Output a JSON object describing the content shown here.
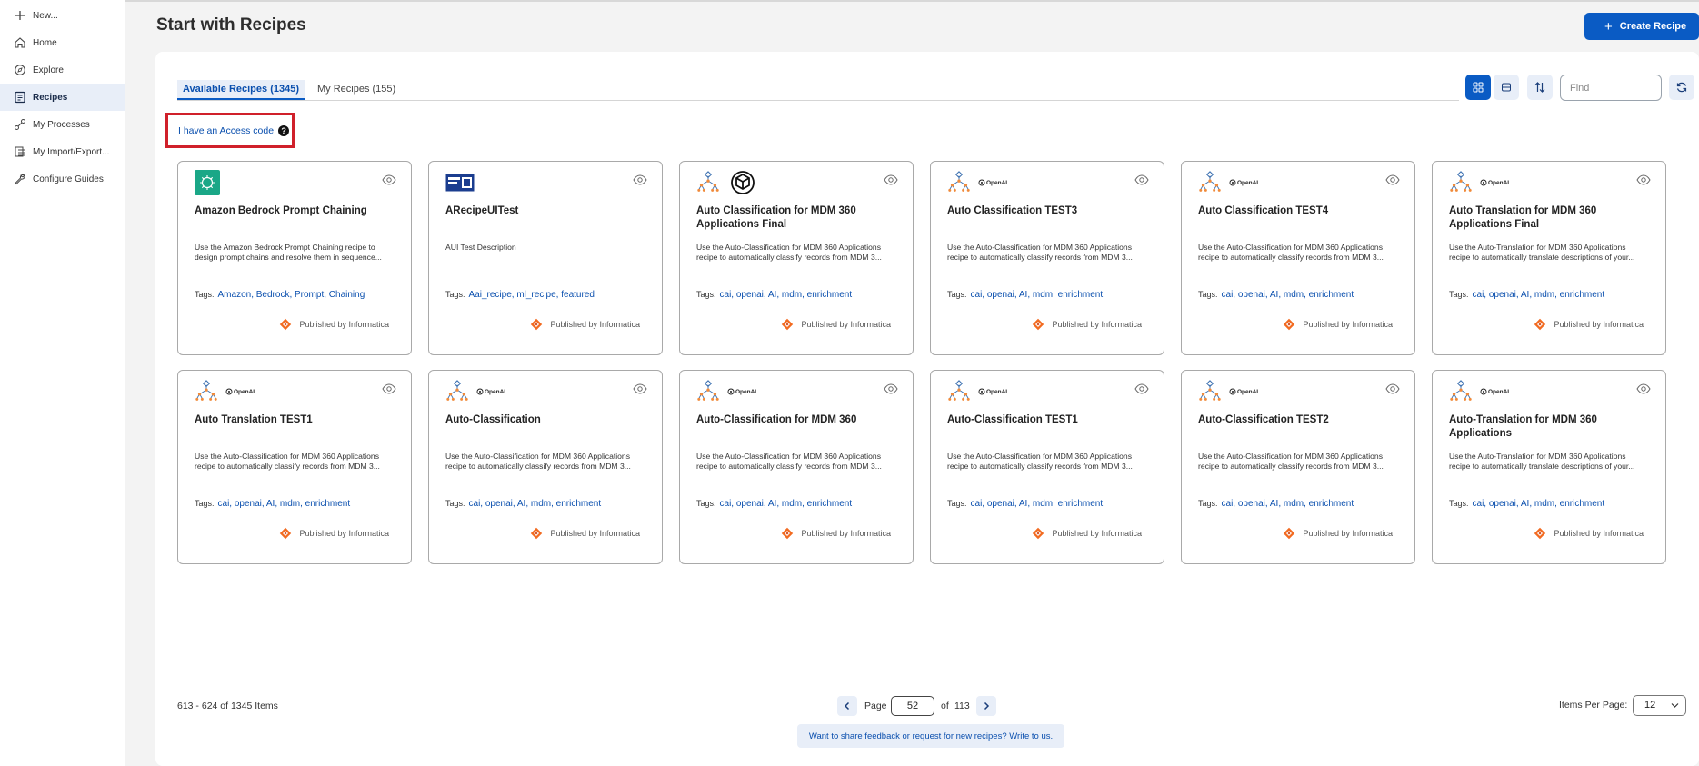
{
  "sidebar": {
    "items": [
      {
        "label": "New...",
        "icon": "plus-icon"
      },
      {
        "label": "Home",
        "icon": "home-icon"
      },
      {
        "label": "Explore",
        "icon": "compass-icon"
      },
      {
        "label": "Recipes",
        "icon": "recipes-icon",
        "active": true
      },
      {
        "label": "My Processes",
        "icon": "process-icon"
      },
      {
        "label": "My Import/Export...",
        "icon": "import-export-icon"
      },
      {
        "label": "Configure Guides",
        "icon": "wrench-icon"
      }
    ]
  },
  "header": {
    "title": "Start with Recipes",
    "create_button": "Create Recipe"
  },
  "tabs": [
    {
      "label": "Available Recipes (1345)",
      "active": true
    },
    {
      "label": "My Recipes (155)",
      "active": false
    }
  ],
  "toolbar": {
    "find_placeholder": "Find",
    "icons": [
      "grid-view-icon",
      "list-view-icon",
      "sort-icon",
      "refresh-icon"
    ]
  },
  "access_code": {
    "label": "I have an Access code",
    "help": "?"
  },
  "publisher_text": "Published by Informatica",
  "tags_label": "Tags:",
  "openai_label": "OpenAI",
  "cards": [
    {
      "title": "Amazon Bedrock Prompt Chaining",
      "desc": "Use the Amazon Bedrock Prompt Chaining recipe to design prompt chains and resolve them in sequence...",
      "tags": "Amazon, Bedrock, Prompt, Chaining",
      "logo": "bedrock"
    },
    {
      "title": "ARecipeUITest",
      "desc": "AUI Test Description",
      "tags": "Aai_recipe, ml_recipe, featured",
      "logo": "window"
    },
    {
      "title": "Auto Classification for MDM 360 Applications Final",
      "desc": "Use the Auto-Classification for MDM 360 Applications recipe to automatically classify records from MDM 3...",
      "tags": "cai, openai, AI, mdm, enrichment",
      "logo": "tree-openai-big"
    },
    {
      "title": "Auto Classification TEST3",
      "desc": "Use the Auto-Classification for MDM 360 Applications recipe to automatically classify records from MDM 3...",
      "tags": "cai, openai, AI, mdm, enrichment",
      "logo": "tree-openai"
    },
    {
      "title": "Auto Classification TEST4",
      "desc": "Use the Auto-Classification for MDM 360 Applications recipe to automatically classify records from MDM 3...",
      "tags": "cai, openai, AI, mdm, enrichment",
      "logo": "tree-openai"
    },
    {
      "title": "Auto Translation for MDM 360 Applications Final",
      "desc": "Use the Auto-Translation for MDM 360 Applications recipe to automatically translate descriptions of your...",
      "tags": "cai, openai, AI, mdm, enrichment",
      "logo": "tree-openai"
    },
    {
      "title": "Auto Translation TEST1",
      "desc": "Use the Auto-Classification for MDM 360 Applications recipe to automatically classify records from MDM 3...",
      "tags": "cai, openai, AI, mdm, enrichment",
      "logo": "tree-openai"
    },
    {
      "title": "Auto-Classification",
      "desc": "Use the Auto-Classification for MDM 360 Applications recipe to automatically classify records from MDM 3...",
      "tags": "cai, openai, AI, mdm, enrichment",
      "logo": "tree-openai"
    },
    {
      "title": "Auto-Classification for MDM 360",
      "desc": "Use the Auto-Classification for MDM 360 Applications recipe to automatically classify records from MDM 3...",
      "tags": "cai, openai, AI, mdm, enrichment",
      "logo": "tree-openai"
    },
    {
      "title": "Auto-Classification TEST1",
      "desc": "Use the Auto-Classification for MDM 360 Applications recipe to automatically classify records from MDM 3...",
      "tags": "cai, openai, AI, mdm, enrichment",
      "logo": "tree-openai"
    },
    {
      "title": "Auto-Classification TEST2",
      "desc": "Use the Auto-Classification for MDM 360 Applications recipe to automatically classify records from MDM 3...",
      "tags": "cai, openai, AI, mdm, enrichment",
      "logo": "tree-openai"
    },
    {
      "title": "Auto-Translation for MDM 360 Applications",
      "desc": "Use the Auto-Translation for MDM 360 Applications recipe to automatically translate descriptions of your...",
      "tags": "cai, openai, AI, mdm, enrichment",
      "logo": "tree-openai"
    }
  ],
  "footer": {
    "items_range": "613 - 624 of 1345 Items",
    "page_label": "Page",
    "page_value": "52",
    "of_label": "of",
    "total_pages": "113",
    "feedback": "Want to share feedback or request for new recipes? Write to us.",
    "items_per_page_label": "Items Per Page:",
    "items_per_page_value": "12"
  },
  "colors": {
    "accent": "#0a5bc4",
    "highlight_box": "#d0202a",
    "informatica_orange": "#f26b21"
  }
}
